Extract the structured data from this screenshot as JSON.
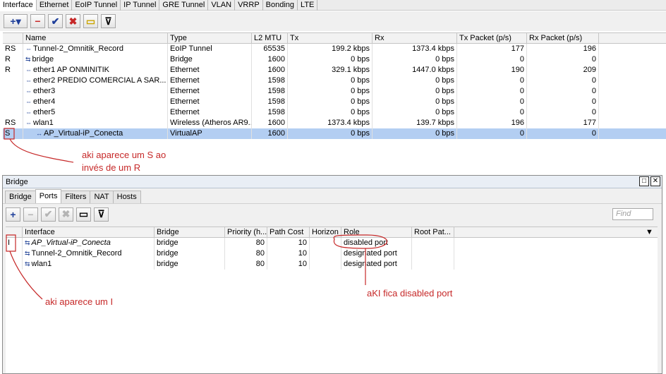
{
  "tabs": [
    "Interface",
    "Ethernet",
    "EoIP Tunnel",
    "IP Tunnel",
    "GRE Tunnel",
    "VLAN",
    "VRRP",
    "Bonding",
    "LTE"
  ],
  "toolbar_icons": [
    "add-icon",
    "remove-icon",
    "enable-icon",
    "disable-icon",
    "comment-icon",
    "filter-icon"
  ],
  "toolbar_glyphs": {
    "add": "+▾",
    "remove": "−",
    "enable": "✔",
    "disable": "✖",
    "comment": "▭",
    "filter": "⊽"
  },
  "interface_table": {
    "headers": [
      "Name",
      "Type",
      "L2 MTU",
      "Tx",
      "Rx",
      "Tx Packet (p/s)",
      "Rx Packet (p/s)"
    ],
    "rows": [
      {
        "flag": "RS",
        "name": "Tunnel-2_Omnitik_Record",
        "type": "EoIP Tunnel",
        "l2mtu": "65535",
        "tx": "199.2 kbps",
        "rx": "1373.4 kbps",
        "txp": "177",
        "rxp": "196"
      },
      {
        "flag": "R",
        "name": "bridge",
        "type": "Bridge",
        "l2mtu": "1600",
        "tx": "0 bps",
        "rx": "0 bps",
        "txp": "0",
        "rxp": "0"
      },
      {
        "flag": "R",
        "name": "ether1 AP ONMINITIK",
        "type": "Ethernet",
        "l2mtu": "1600",
        "tx": "329.1 kbps",
        "rx": "1447.0 kbps",
        "txp": "190",
        "rxp": "209"
      },
      {
        "flag": "",
        "name": "ether2 PREDIO COMERCIAL A SAR...",
        "type": "Ethernet",
        "l2mtu": "1598",
        "tx": "0 bps",
        "rx": "0 bps",
        "txp": "0",
        "rxp": "0"
      },
      {
        "flag": "",
        "name": "ether3",
        "type": "Ethernet",
        "l2mtu": "1598",
        "tx": "0 bps",
        "rx": "0 bps",
        "txp": "0",
        "rxp": "0"
      },
      {
        "flag": "",
        "name": "ether4",
        "type": "Ethernet",
        "l2mtu": "1598",
        "tx": "0 bps",
        "rx": "0 bps",
        "txp": "0",
        "rxp": "0"
      },
      {
        "flag": "",
        "name": "ether5",
        "type": "Ethernet",
        "l2mtu": "1598",
        "tx": "0 bps",
        "rx": "0 bps",
        "txp": "0",
        "rxp": "0"
      },
      {
        "flag": "RS",
        "name": "wlan1",
        "type": "Wireless (Atheros AR9...",
        "l2mtu": "1600",
        "tx": "1373.4 kbps",
        "rx": "139.7 kbps",
        "txp": "196",
        "rxp": "177"
      },
      {
        "flag": "S",
        "name": "AP_Virtual-iP_Conecta",
        "type": "VirtualAP",
        "l2mtu": "1600",
        "tx": "0 bps",
        "rx": "0 bps",
        "txp": "0",
        "rxp": "0"
      }
    ]
  },
  "annotations": {
    "a1_line1": "aki aparece um S ao",
    "a1_line2": "invés de um R",
    "a2": "aki aparece um I",
    "a3": "aKI fica disabled port"
  },
  "bridge_window": {
    "title": "Bridge",
    "tabs": [
      "Bridge",
      "Ports",
      "Filters",
      "NAT",
      "Hosts"
    ],
    "find_placeholder": "Find",
    "headers": [
      "Interface",
      "Bridge",
      "Priority (h...",
      "Path Cost",
      "Horizon",
      "Role",
      "Root Pat..."
    ],
    "rows": [
      {
        "flag": "I",
        "interface": "AP_Virtual-iP_Conecta",
        "bridge": "bridge",
        "priority": "80",
        "path_cost": "10",
        "horizon": "",
        "role": "disabled port",
        "root_path": ""
      },
      {
        "flag": "",
        "interface": "Tunnel-2_Omnitik_Record",
        "bridge": "bridge",
        "priority": "80",
        "path_cost": "10",
        "horizon": "",
        "role": "designated port",
        "root_path": ""
      },
      {
        "flag": "",
        "interface": "wlan1",
        "bridge": "bridge",
        "priority": "80",
        "path_cost": "10",
        "horizon": "",
        "role": "designated port",
        "root_path": ""
      }
    ]
  },
  "colors": {
    "selected_row": "#b3cef2",
    "annotation": "#c62828",
    "accent_blue": "#1f3f9a"
  }
}
